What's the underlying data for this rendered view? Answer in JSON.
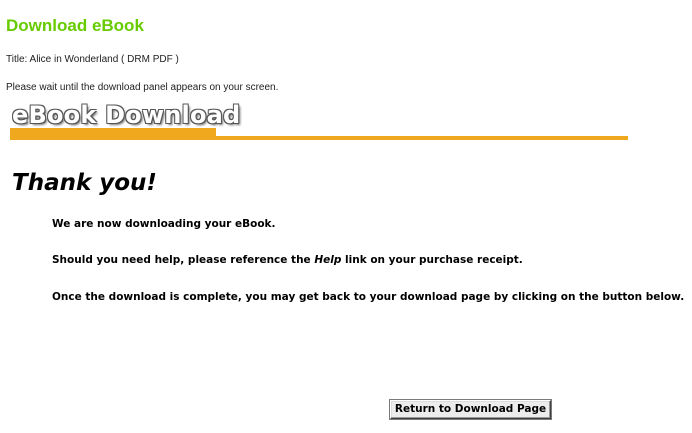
{
  "page": {
    "heading": "Download eBook",
    "title_line": "Title: Alice in Wonderland ( DRM PDF )",
    "wait_line": "Please wait until the download panel appears on your screen."
  },
  "banner": {
    "title": "eBook Download",
    "accent_color": "#f0a81e"
  },
  "main": {
    "thanks": "Thank you!",
    "message_1": "We are now downloading your eBook.",
    "message_2_before": "Should you need help, please reference the ",
    "message_2_emphasis": "Help",
    "message_2_after": " link on your purchase receipt.",
    "message_3": "Once the download is complete, you may get back to your download page by clicking on the button below."
  },
  "actions": {
    "return_label": "Return to Download Page"
  },
  "colors": {
    "heading": "#66cc00"
  }
}
